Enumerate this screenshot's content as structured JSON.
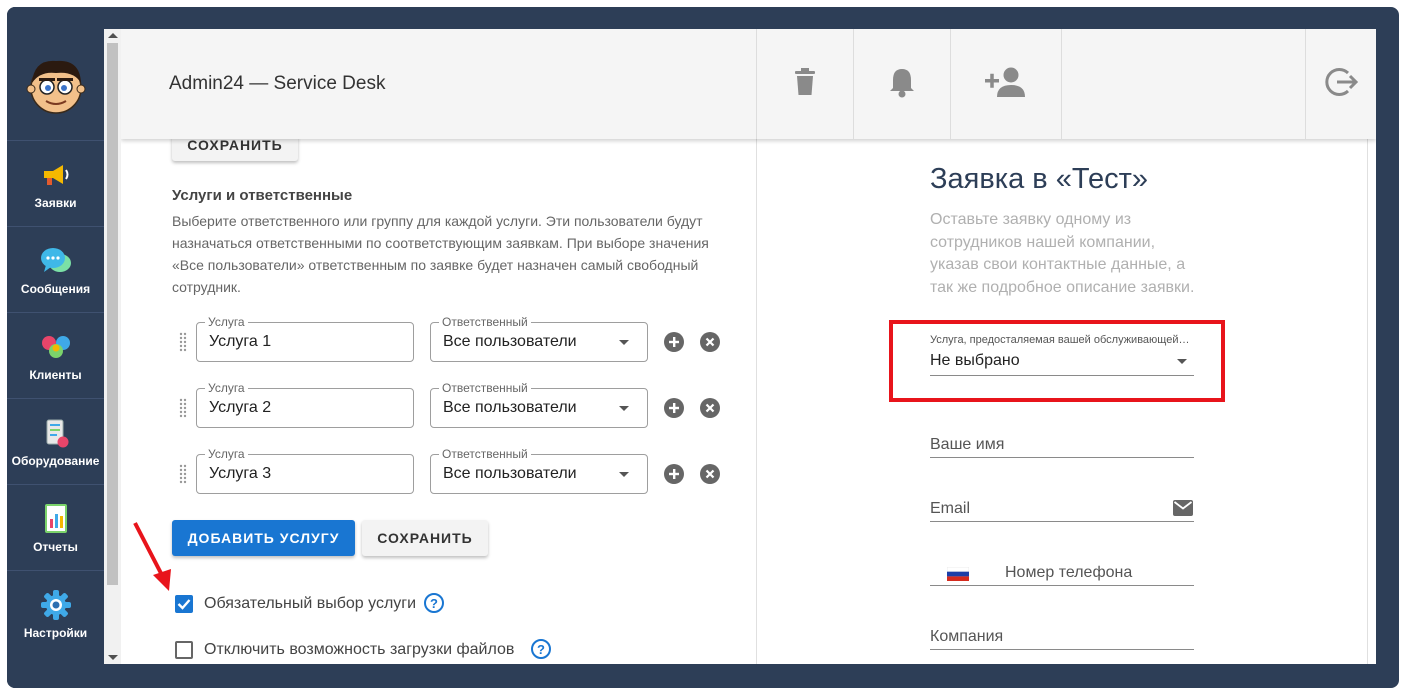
{
  "app": {
    "title": "Admin24 — Service Desk"
  },
  "sidebar": {
    "items": [
      {
        "label": "Заявки",
        "icon": "megaphone-icon"
      },
      {
        "label": "Сообщения",
        "icon": "chat-bubbles-icon"
      },
      {
        "label": "Клиенты",
        "icon": "clients-icon"
      },
      {
        "label": "Оборудование",
        "icon": "equipment-icon"
      },
      {
        "label": "Отчеты",
        "icon": "reports-icon"
      },
      {
        "label": "Настройки",
        "icon": "gear-icon"
      }
    ]
  },
  "toolbar": {
    "buttons": [
      "trash-icon",
      "bell-icon",
      "add-user-icon",
      "logout-icon"
    ]
  },
  "left": {
    "top_save_label": "СОХРАНИТЬ",
    "section_title": "Услуги и ответственные",
    "section_desc": "Выберите ответственного или группу для каждой услуги. Эти пользователи будут назначаться ответственными по соответствующим заявкам. При выборе значения «Все пользователи» ответственным по заявке будет назначен самый свободный сотрудник.",
    "service_legend": "Услуга",
    "responsible_legend": "Ответственный",
    "rows": [
      {
        "service": "Услуга 1",
        "responsible": "Все пользователи"
      },
      {
        "service": "Услуга 2",
        "responsible": "Все пользователи"
      },
      {
        "service": "Услуга 3",
        "responsible": "Все пользователи"
      }
    ],
    "add_service_label": "ДОБАВИТЬ УСЛУГУ",
    "save_label": "СОХРАНИТЬ",
    "checkboxes": [
      {
        "label": "Обязательный выбор услуги",
        "checked": true
      },
      {
        "label": "Отключить возможность загрузки файлов",
        "checked": false
      }
    ],
    "help_glyph": "?"
  },
  "form": {
    "title": "Заявка в «Тест»",
    "description": "Оставьте заявку одному из сотрудников нашей компании, указав свои контактные данные, а так же подробное описание заявки.",
    "service_select_label": "Услуга, предосталяемая вашей обслуживающей организацией",
    "service_select_value": "Не выбрано",
    "name_label": "Ваше имя",
    "email_label": "Email",
    "phone_label": "Номер телефона",
    "company_label": "Компания"
  },
  "colors": {
    "sidebar": "#2d3e57",
    "primary": "#1976d2",
    "highlight": "#e8141b",
    "annotation_arrow": "#e8141b"
  }
}
